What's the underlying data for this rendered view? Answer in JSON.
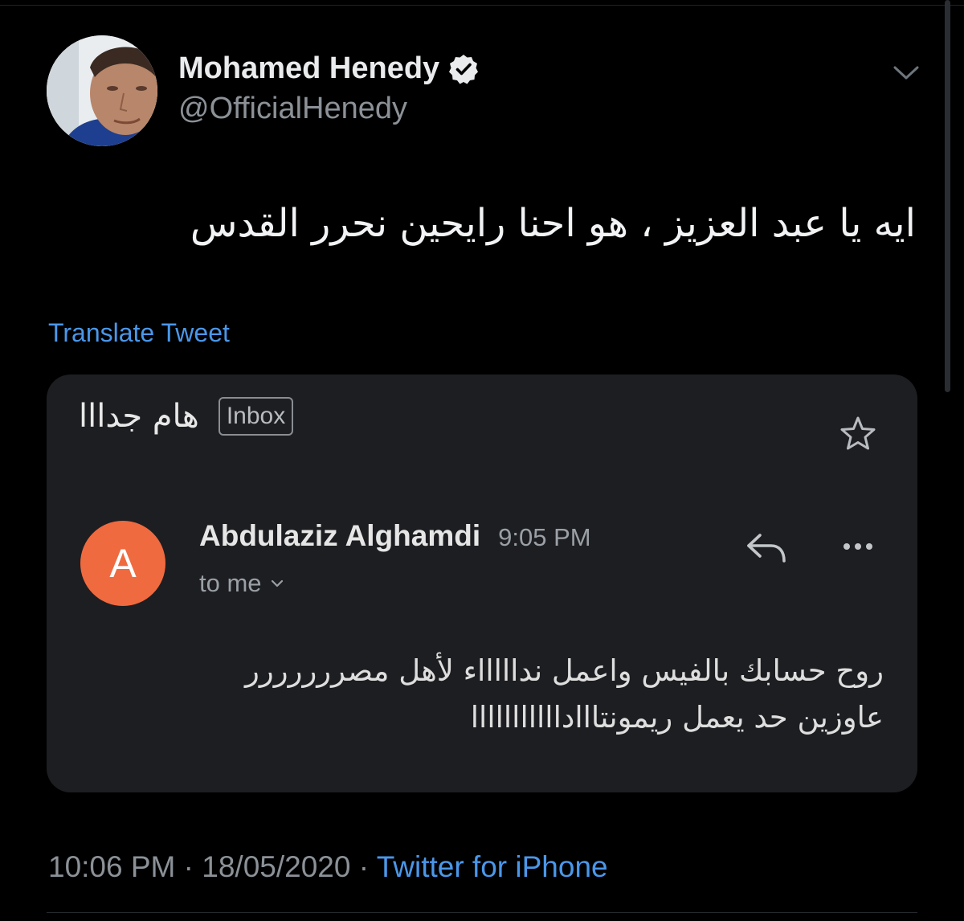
{
  "tweet": {
    "author": {
      "display_name": "Mohamed Henedy",
      "handle": "@OfficialHenedy",
      "verified": true
    },
    "text": "ايه يا عبد العزيز ، هو احنا رايحين نحرر القدس",
    "translate_label": "Translate Tweet",
    "timestamp": "10:06 PM",
    "date": "18/05/2020",
    "separator": "·",
    "source": "Twitter for iPhone"
  },
  "email_card": {
    "subject": "هام جدااا",
    "folder_badge": "Inbox",
    "sender_initial": "A",
    "sender_name": "Abdulaziz Alghamdi",
    "time": "9:05 PM",
    "recipient": "to me",
    "body_line1": "روح حسابك بالفيس واعمل نداااااء لأهل مصررررررر",
    "body_line2": "عاوزين حد يعمل ريمونتااادااااااااااا"
  },
  "icons": {
    "verified": "verified-badge-icon",
    "menu": "chevron-down-icon",
    "star": "star-icon",
    "reply": "reply-icon",
    "more": "more-icon",
    "recipient_expand": "small-chevron-down-icon"
  },
  "colors": {
    "background": "#000000",
    "link": "#4a97ea",
    "card": "#1d1e21",
    "sender_avatar": "#f06a3f"
  }
}
